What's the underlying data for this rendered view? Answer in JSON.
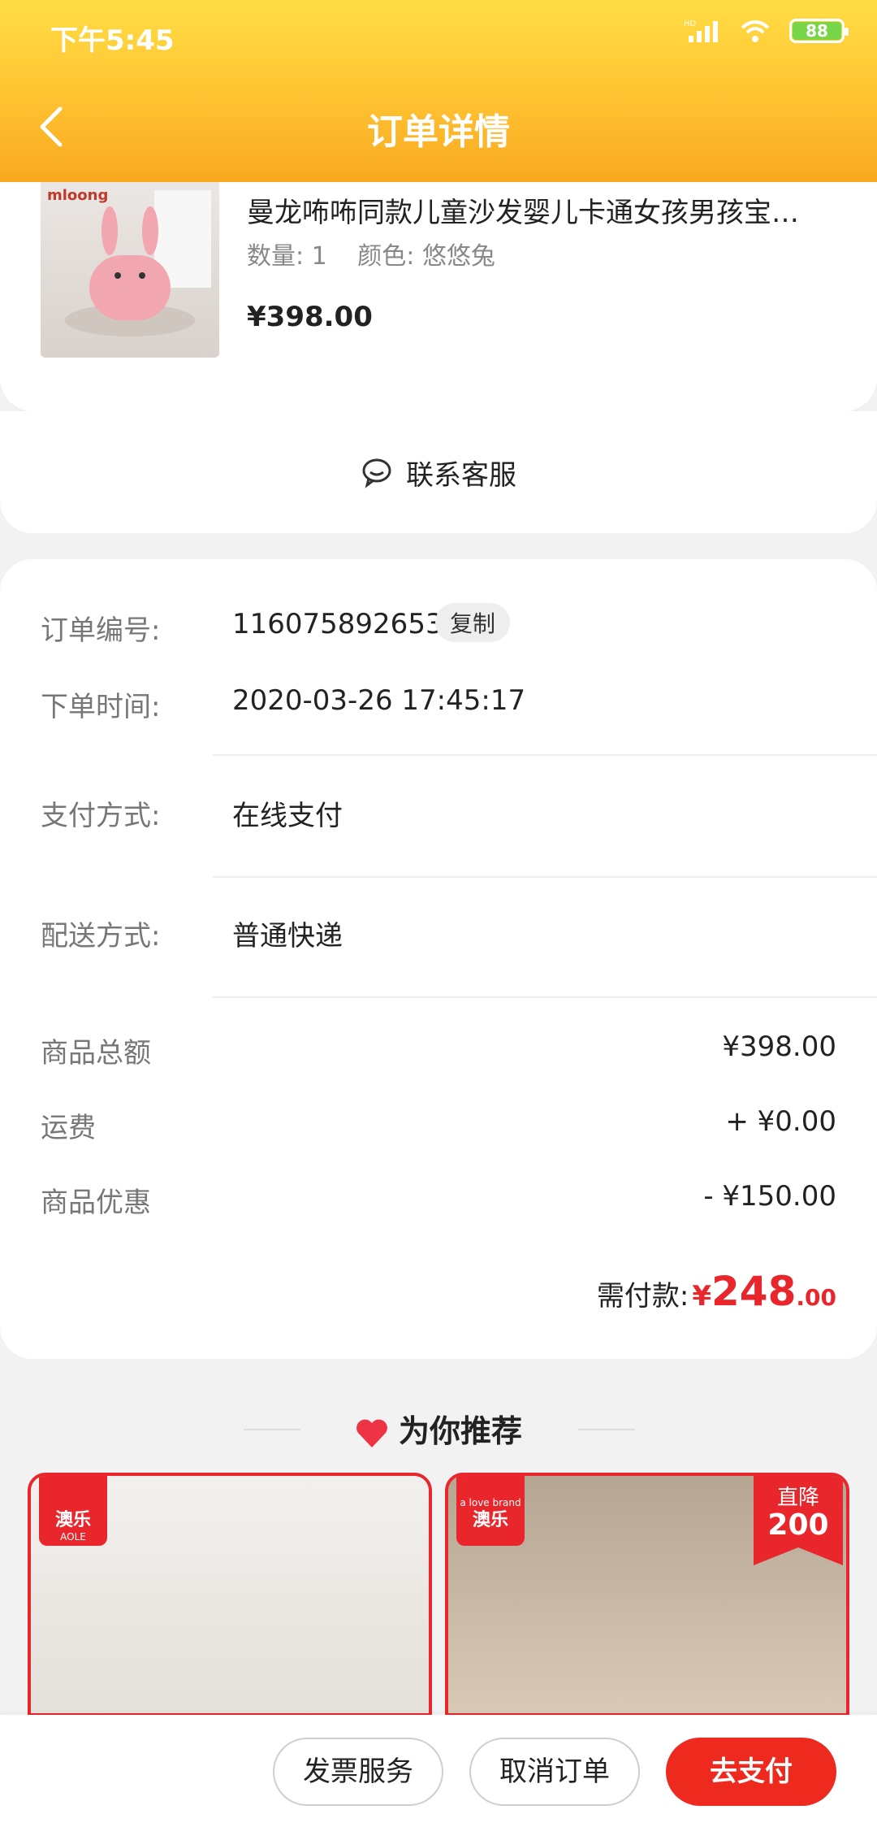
{
  "status_bar": {
    "time": "下午5:45",
    "battery": "88",
    "network": "HD"
  },
  "header": {
    "title": "订单详情"
  },
  "product": {
    "title": "曼龙咘咘同款儿童沙发婴儿卡通女孩男孩宝…",
    "quantity": "数量: 1",
    "color": "颜色: 悠悠兔",
    "price": "¥398.00",
    "brand": "mloong"
  },
  "service": {
    "label": "联系客服"
  },
  "order": {
    "number_label": "订单编号:",
    "number": "116075892653",
    "copy": "复制",
    "time_label": "下单时间:",
    "time": "2020-03-26 17:45:17",
    "payment_label": "支付方式:",
    "payment": "在线支付",
    "delivery_label": "配送方式:",
    "delivery": "普通快递",
    "subtotal_label": "商品总额",
    "subtotal": "¥398.00",
    "shipping_label": "运费",
    "shipping": "+ ¥0.00",
    "discount_label": "商品优惠",
    "discount": "- ¥150.00",
    "payable_label": "需付款:",
    "payable_symbol": "¥",
    "payable_int": "248",
    "payable_dec": ".00"
  },
  "recommend": {
    "title": "为你推荐",
    "items": [
      {
        "brand": "澳乐",
        "brand_sub": "AOLE"
      },
      {
        "brand": "澳乐",
        "brand_sub": "a love brand",
        "badge_line1": "直降",
        "badge_line2": "200"
      }
    ]
  },
  "actions": {
    "invoice": "发票服务",
    "cancel": "取消订单",
    "pay": "去支付"
  },
  "colors": {
    "header_top": "#ffdd44",
    "header_bottom": "#f9a820",
    "accent": "#e8262b",
    "pay_button": "#ee2a1f"
  }
}
